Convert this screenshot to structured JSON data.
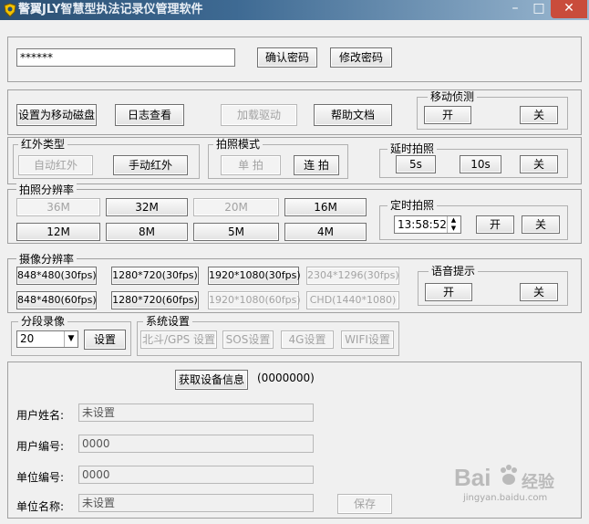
{
  "window": {
    "title": "警翼JLY智慧型执法记录仪管理软件",
    "minimize": "–",
    "maximize": "□",
    "close": "✕"
  },
  "password": {
    "value": "******",
    "confirm": "确认密码",
    "change": "修改密码"
  },
  "toolbar": {
    "mobile_disk": "设置为移动磁盘",
    "log": "日志查看",
    "load_driver": "加载驱动",
    "help": "帮助文档"
  },
  "motion": {
    "label": "移动侦测",
    "on": "开",
    "off": "关"
  },
  "infrared": {
    "label": "红外类型",
    "auto": "自动红外",
    "manual": "手动红外"
  },
  "photo_mode": {
    "label": "拍照模式",
    "single": "单 拍",
    "burst": "连 拍"
  },
  "delay_photo": {
    "label": "延时拍照",
    "s5": "5s",
    "s10": "10s",
    "off": "关"
  },
  "photo_res": {
    "label": "拍照分辨率",
    "row1": [
      "36M",
      "32M",
      "20M",
      "16M"
    ],
    "row2": [
      "12M",
      "8M",
      "5M",
      "4M"
    ]
  },
  "timed_photo": {
    "label": "定时拍照",
    "time": "13:58:52",
    "on": "开",
    "off": "关"
  },
  "video_res": {
    "label": "摄像分辨率",
    "row1": [
      "848*480(30fps)",
      "1280*720(30fps)",
      "1920*1080(30fps)",
      "2304*1296(30fps)"
    ],
    "row2": [
      "848*480(60fps)",
      "1280*720(60fps)",
      "1920*1080(60fps)",
      "CHD(1440*1080)"
    ]
  },
  "voice": {
    "label": "语音提示",
    "on": "开",
    "off": "关"
  },
  "segment": {
    "label": "分段录像",
    "value": "20",
    "set": "设置"
  },
  "system": {
    "label": "系统设置",
    "gps": "北斗/GPS 设置",
    "sos": "SOS设置",
    "g4": "4G设置",
    "wifi": "WIFI设置"
  },
  "device": {
    "get_info": "获取设备信息",
    "code": "(0000000)",
    "user_name_label": "用户姓名:",
    "user_name": "未设置",
    "user_id_label": "用户编号:",
    "user_id": "0000",
    "unit_id_label": "单位编号:",
    "unit_id": "0000",
    "unit_name_label": "单位名称:",
    "unit_name": "未设置",
    "save": "保存"
  },
  "watermark": {
    "brand": "Bai",
    "brand2": "经验",
    "url": "jingyan.baidu.com"
  }
}
